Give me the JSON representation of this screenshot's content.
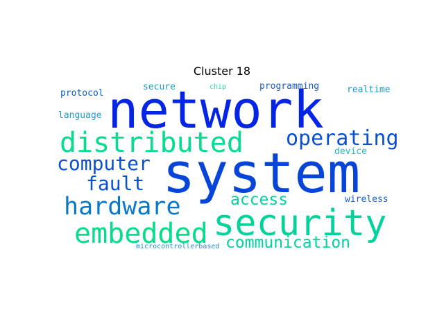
{
  "title": "Cluster 18",
  "words": [
    {
      "text": "network",
      "color": "#0424e6"
    },
    {
      "text": "system",
      "color": "#0744d8"
    },
    {
      "text": "security",
      "color": "#03d39a"
    },
    {
      "text": "distributed",
      "color": "#05dc8e"
    },
    {
      "text": "embedded",
      "color": "#06dc8b"
    },
    {
      "text": "hardware",
      "color": "#0a78c8"
    },
    {
      "text": "operating",
      "color": "#0a4fd2"
    },
    {
      "text": "computer",
      "color": "#0a50d6"
    },
    {
      "text": "fault",
      "color": "#0a52d2"
    },
    {
      "text": "access",
      "color": "#04d19f"
    },
    {
      "text": "communication",
      "color": "#05d1a0"
    },
    {
      "text": "protocol",
      "color": "#0b5fc8"
    },
    {
      "text": "secure",
      "color": "#1aa0c0"
    },
    {
      "text": "chip",
      "color": "#22e6a0"
    },
    {
      "text": "programming",
      "color": "#1a5ad0"
    },
    {
      "text": "realtime",
      "color": "#1f97c8"
    },
    {
      "text": "language",
      "color": "#1f9ccc"
    },
    {
      "text": "device",
      "color": "#25b9c6"
    },
    {
      "text": "wireless",
      "color": "#1460d0"
    },
    {
      "text": "microcontrollerbased",
      "color": "#1e90cc"
    }
  ]
}
